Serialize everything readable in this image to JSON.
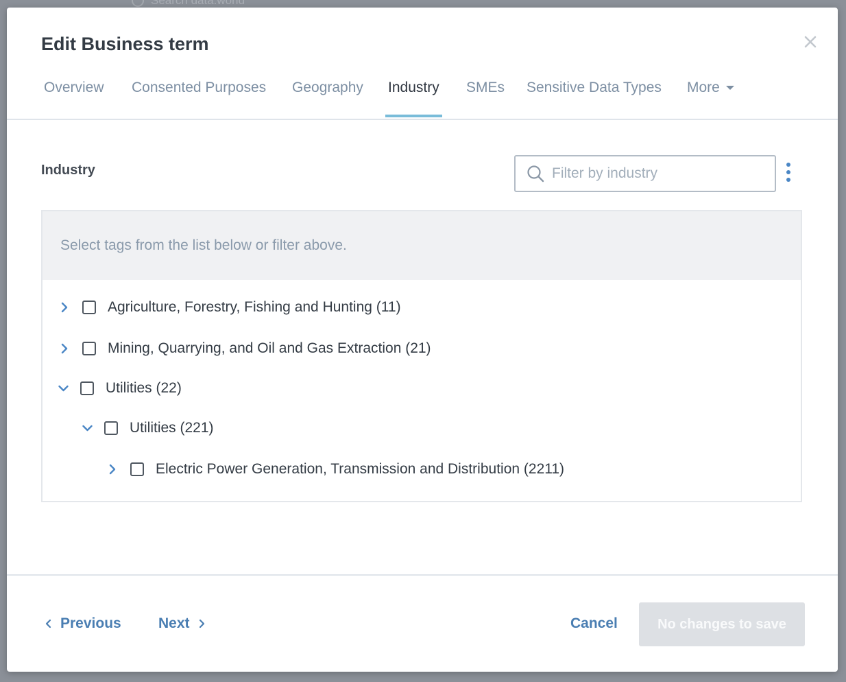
{
  "backdrop": {
    "search_placeholder": "Search data.world"
  },
  "modal": {
    "title": "Edit Business term",
    "tabs": [
      {
        "label": "Overview"
      },
      {
        "label": "Consented Purposes"
      },
      {
        "label": "Geography"
      },
      {
        "label": "Industry",
        "active": true
      },
      {
        "label": "SMEs"
      },
      {
        "label": "Sensitive Data Types"
      },
      {
        "label": "More"
      }
    ],
    "section": {
      "label": "Industry",
      "filter_placeholder": "Filter by industry",
      "hint": "Select tags from the list below or filter above."
    },
    "tree": [
      {
        "label": "Agriculture, Forestry, Fishing and Hunting (11)",
        "level": 0,
        "expanded": false,
        "checked": false
      },
      {
        "label": "Mining, Quarrying, and Oil and Gas Extraction (21)",
        "level": 0,
        "expanded": false,
        "checked": false
      },
      {
        "label": "Utilities (22)",
        "level": 0,
        "expanded": true,
        "checked": false
      },
      {
        "label": "Utilities (221)",
        "level": 1,
        "expanded": true,
        "checked": false
      },
      {
        "label": "Electric Power Generation, Transmission and Distribution (2211)",
        "level": 2,
        "expanded": false,
        "checked": false
      }
    ],
    "footer": {
      "previous_label": "Previous",
      "next_label": "Next",
      "cancel_label": "Cancel",
      "save_label": "No changes to save"
    }
  },
  "colors": {
    "accent_link": "#4a7eb2",
    "active_tab_underline": "#79bcd9",
    "disabled_button": "#dde0e4"
  }
}
